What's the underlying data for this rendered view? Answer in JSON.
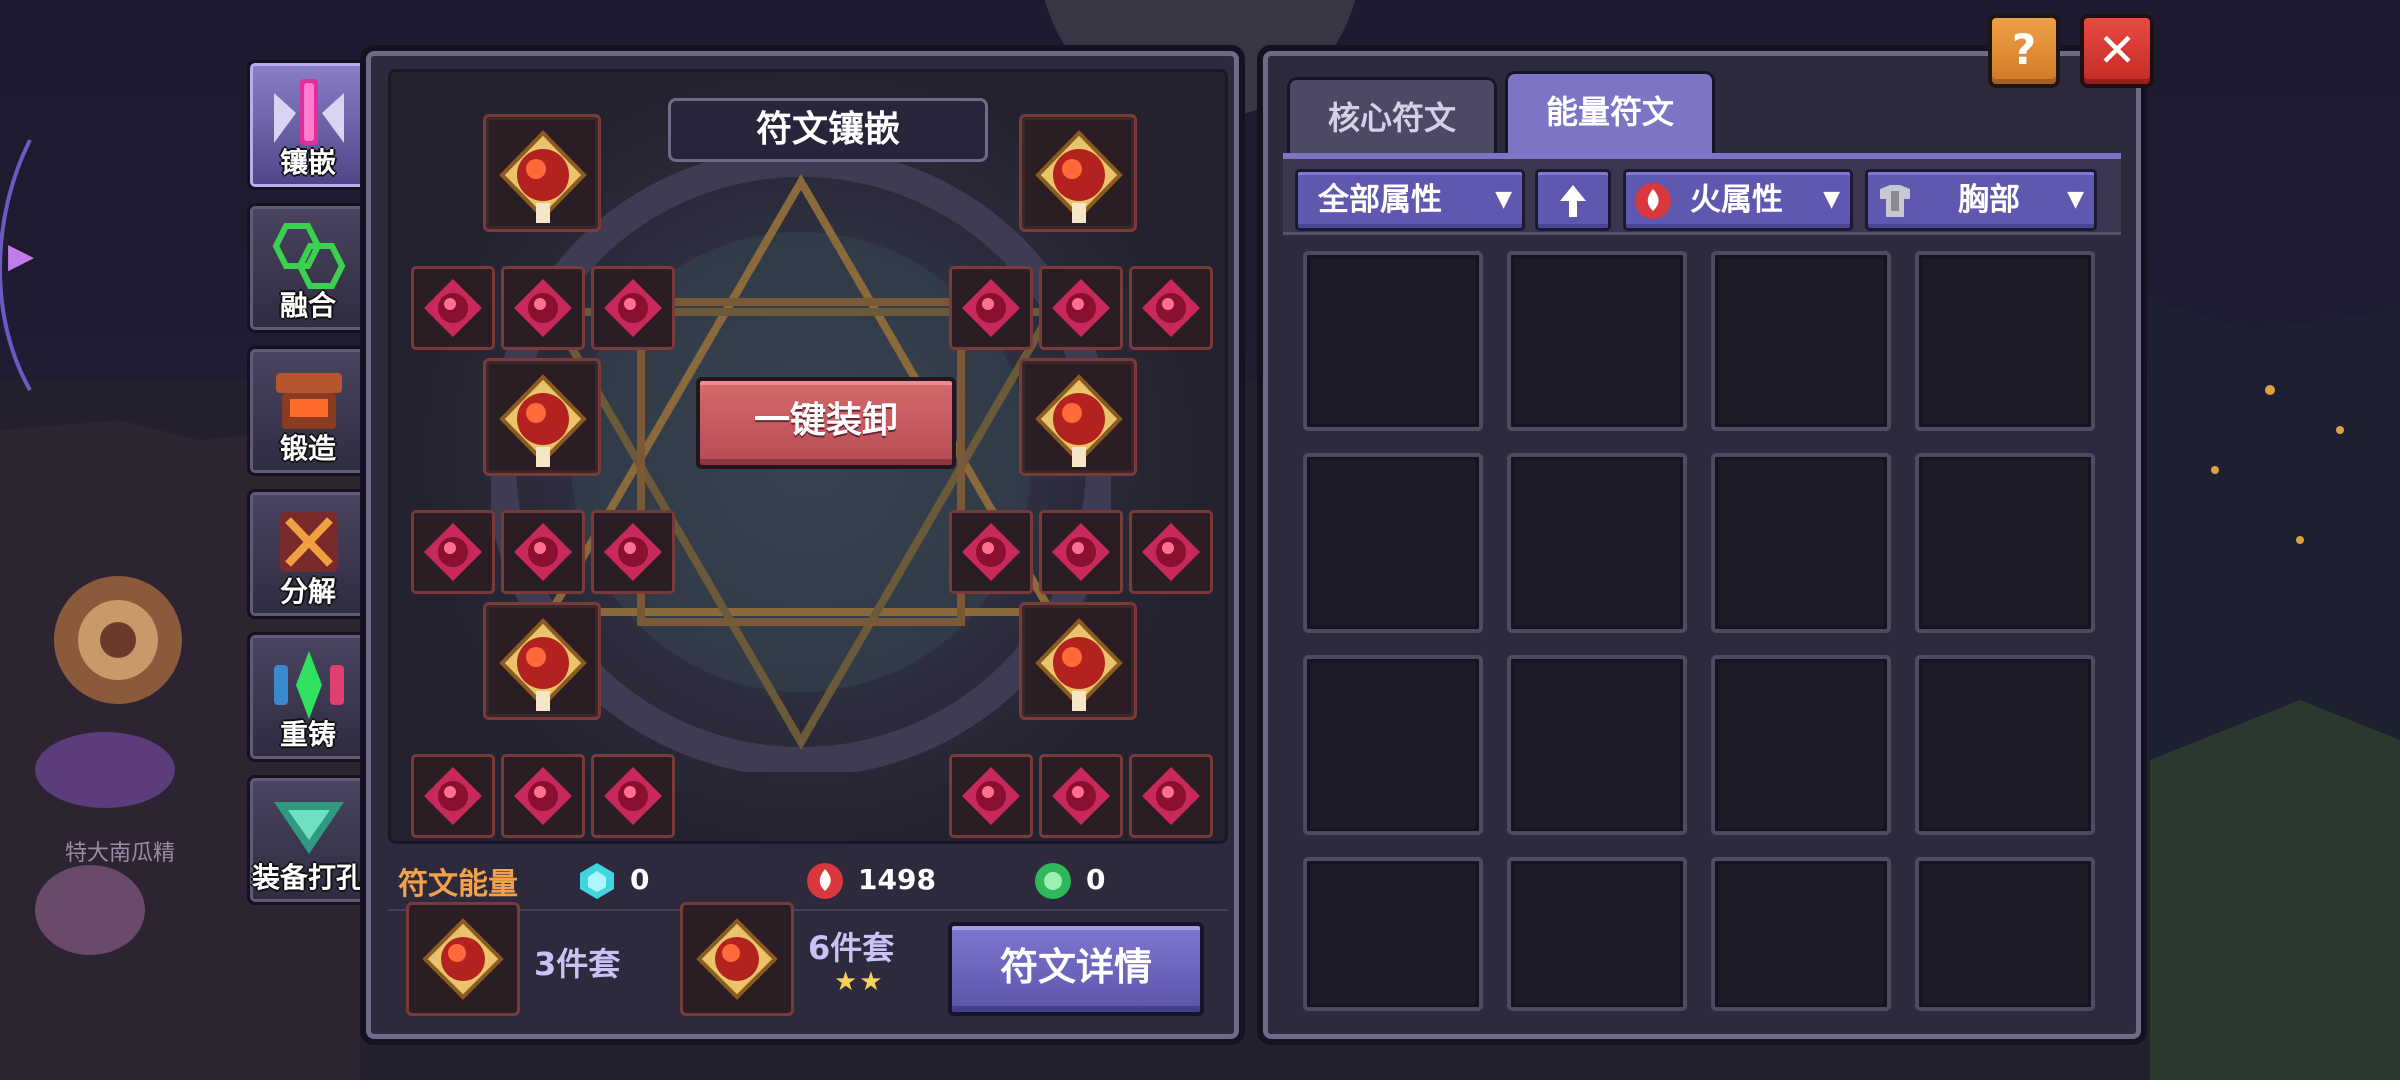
{
  "side_tabs": [
    {
      "label": "镶嵌",
      "active": true
    },
    {
      "label": "融合",
      "active": false
    },
    {
      "label": "锻造",
      "active": false
    },
    {
      "label": "分解",
      "active": false
    },
    {
      "label": "重铸",
      "active": false
    },
    {
      "label": "装备打孔",
      "active": false
    }
  ],
  "background": {
    "npc_name": "特大南瓜精"
  },
  "left_panel": {
    "title": "符文镶嵌",
    "unequip_all_label": "一键装卸",
    "energy": {
      "label": "符文能量",
      "items": [
        {
          "icon": "cyan-gem-icon",
          "value": "0"
        },
        {
          "icon": "fire-gem-icon",
          "value": "1498"
        },
        {
          "icon": "green-gem-icon",
          "value": "0"
        }
      ]
    },
    "sets": [
      {
        "label": "3件套",
        "stars": ""
      },
      {
        "label": "6件套",
        "stars": "★★"
      }
    ],
    "detail_label": "符文详情"
  },
  "right_panel": {
    "tabs": [
      {
        "label": "核心符文",
        "active": false
      },
      {
        "label": "能量符文",
        "active": true
      }
    ],
    "filters": {
      "attribute": "全部属性",
      "sort_icon": "arrow-up-icon",
      "element": "火属性",
      "slot": "胸部"
    }
  },
  "buttons": {
    "help": "?",
    "close": "✕"
  },
  "colors": {
    "accent": "#7c75c6",
    "fire": "#c9302c",
    "energy_label": "#f2a24a",
    "unequip": "#c9575d"
  }
}
